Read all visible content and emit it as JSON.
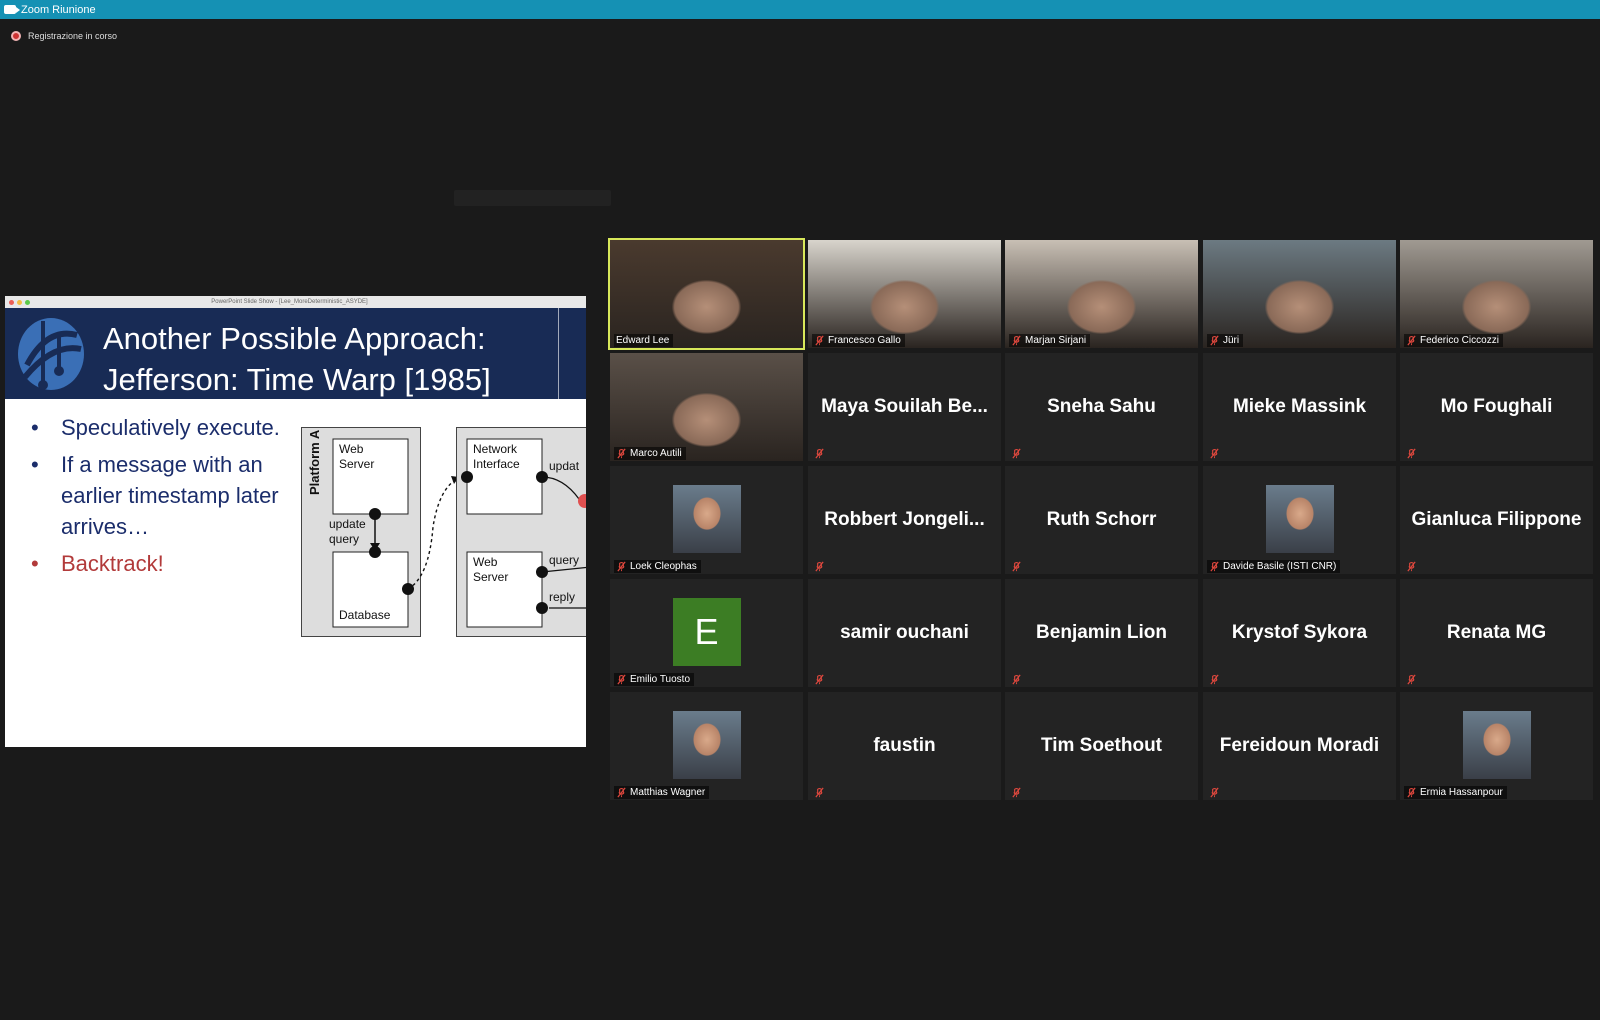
{
  "window": {
    "title": "Zoom Riunione"
  },
  "recording": {
    "label": "Registrazione in corso"
  },
  "slide": {
    "window_title": "PowerPoint Slide Show - [Lee_MoreDeterministic_ASYDE]",
    "title": "Another Possible Approach:\nJefferson: Time Warp [1985]",
    "bullets": [
      {
        "text": "Speculatively execute.",
        "accent": false
      },
      {
        "text": "If a message with an earlier timestamp later arrives…",
        "accent": false
      },
      {
        "text": "Backtrack!",
        "accent": true
      }
    ],
    "diagram": {
      "platform_label": "Platform A",
      "web_server": "Web\nServer",
      "update_query": "update\nquery",
      "database": "Database",
      "network_interface": "Network\nInterface",
      "update_short": "updat",
      "web_server_2": "Web\nServer",
      "query": "query",
      "reply": "reply"
    },
    "colors": {
      "header": "#182b55",
      "bullet_text": "#1b2d6b",
      "accent": "#b23a3a"
    }
  },
  "participants": [
    {
      "name": "Edward Lee",
      "kind": "video",
      "active": true,
      "muted": false
    },
    {
      "name": "Francesco Gallo",
      "kind": "video",
      "active": false,
      "muted": true
    },
    {
      "name": "Marjan Sirjani",
      "kind": "video",
      "active": false,
      "muted": true
    },
    {
      "name": "Jüri",
      "kind": "video",
      "active": false,
      "muted": true
    },
    {
      "name": "Federico Ciccozzi",
      "kind": "video",
      "active": false,
      "muted": true
    },
    {
      "name": "Marco Autili",
      "kind": "video",
      "active": false,
      "muted": true
    },
    {
      "name": "Maya Souilah Be...",
      "kind": "name",
      "active": false,
      "muted": true
    },
    {
      "name": "Sneha Sahu",
      "kind": "name",
      "active": false,
      "muted": true
    },
    {
      "name": "Mieke Massink",
      "kind": "name",
      "active": false,
      "muted": true
    },
    {
      "name": "Mo Foughali",
      "kind": "name",
      "active": false,
      "muted": true
    },
    {
      "name": "Loek Cleophas",
      "kind": "avatar",
      "active": false,
      "muted": true
    },
    {
      "name": "Robbert Jongeli...",
      "kind": "name",
      "active": false,
      "muted": true
    },
    {
      "name": "Ruth Schorr",
      "kind": "name",
      "active": false,
      "muted": true
    },
    {
      "name": "Davide Basile (ISTI CNR)",
      "kind": "avatar",
      "active": false,
      "muted": true
    },
    {
      "name": "Gianluca Filippone",
      "kind": "name",
      "active": false,
      "muted": true
    },
    {
      "name": "Emilio Tuosto",
      "kind": "letter",
      "letter": "E",
      "active": false,
      "muted": true
    },
    {
      "name": "samir ouchani",
      "kind": "name",
      "active": false,
      "muted": true
    },
    {
      "name": "Benjamin Lion",
      "kind": "name",
      "active": false,
      "muted": true
    },
    {
      "name": "Krystof Sykora",
      "kind": "name",
      "active": false,
      "muted": true
    },
    {
      "name": "Renata MG",
      "kind": "name",
      "active": false,
      "muted": true
    },
    {
      "name": "Matthias Wagner",
      "kind": "avatar",
      "active": false,
      "muted": true
    },
    {
      "name": "faustin",
      "kind": "name",
      "active": false,
      "muted": true
    },
    {
      "name": "Tim Soethout",
      "kind": "name",
      "active": false,
      "muted": true
    },
    {
      "name": "Fereidoun Moradi",
      "kind": "name",
      "active": false,
      "muted": true
    },
    {
      "name": "Ermia Hassanpour",
      "kind": "avatar",
      "active": false,
      "muted": true
    }
  ],
  "colors": {
    "titlebar": "#1591b4",
    "background": "#1a1a1a",
    "tile": "#232323",
    "active_border": "#d8e85a",
    "mute_icon": "#e0483e",
    "letter_avatar": "#3c7d24"
  }
}
